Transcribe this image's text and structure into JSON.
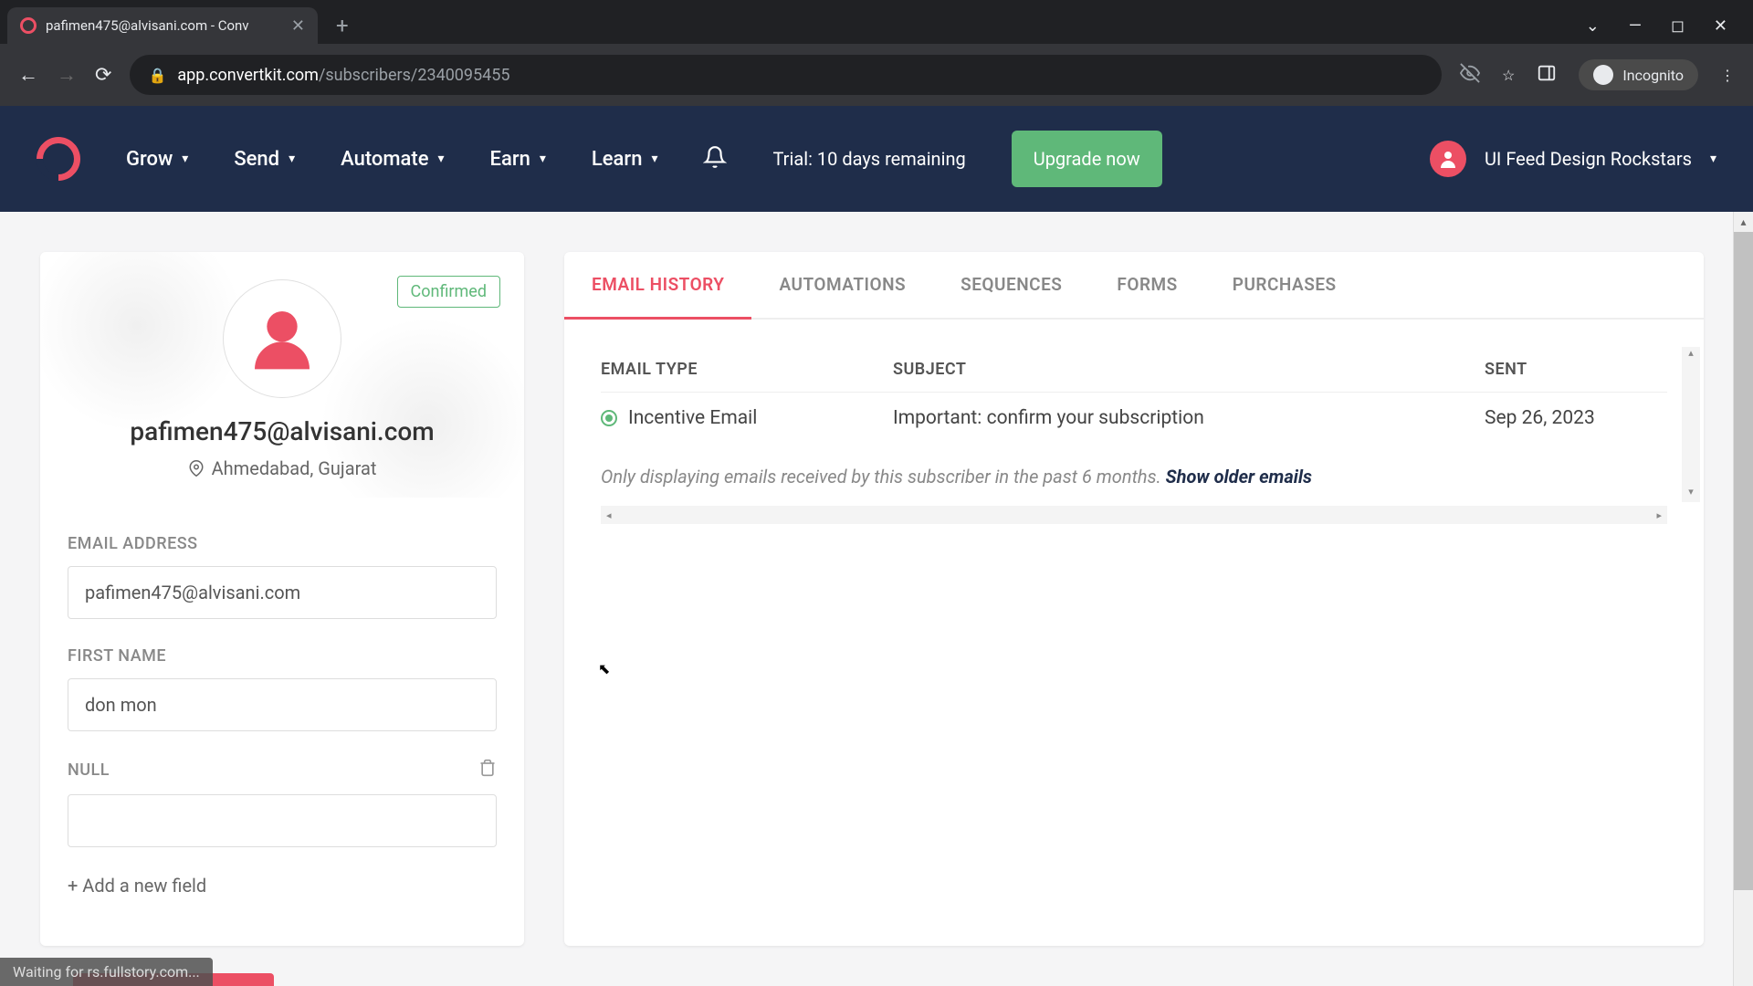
{
  "browser": {
    "tab_title": "pafimen475@alvisani.com - Conv",
    "url_domain": "app.convertkit.com",
    "url_path": "/subscribers/2340095455",
    "incognito_label": "Incognito",
    "status_text": "Waiting for rs.fullstory.com..."
  },
  "nav": {
    "items": [
      "Grow",
      "Send",
      "Automate",
      "Earn",
      "Learn"
    ],
    "trial_text": "Trial: 10 days remaining",
    "upgrade_label": "Upgrade now",
    "account_name": "UI Feed Design Rockstars"
  },
  "profile": {
    "status_badge": "Confirmed",
    "email_display": "pafimen475@alvisani.com",
    "location": "Ahmedabad, Gujarat",
    "fields": {
      "email_label": "EMAIL ADDRESS",
      "email_value": "pafimen475@alvisani.com",
      "firstname_label": "FIRST NAME",
      "firstname_value": "don mon",
      "null_label": "NULL",
      "null_value": ""
    },
    "add_field_label": "+ Add a new field"
  },
  "tabs": {
    "items": [
      "EMAIL HISTORY",
      "AUTOMATIONS",
      "SEQUENCES",
      "FORMS",
      "PURCHASES"
    ],
    "active_index": 0
  },
  "table": {
    "headers": {
      "type": "EMAIL TYPE",
      "subject": "SUBJECT",
      "sent": "SENT"
    },
    "rows": [
      {
        "type": "Incentive Email",
        "subject": "Important: confirm your subscription",
        "sent": "Sep 26, 2023"
      }
    ],
    "older_note": "Only displaying emails received by this subscriber in the past 6 months. ",
    "older_link": "Show older emails"
  }
}
